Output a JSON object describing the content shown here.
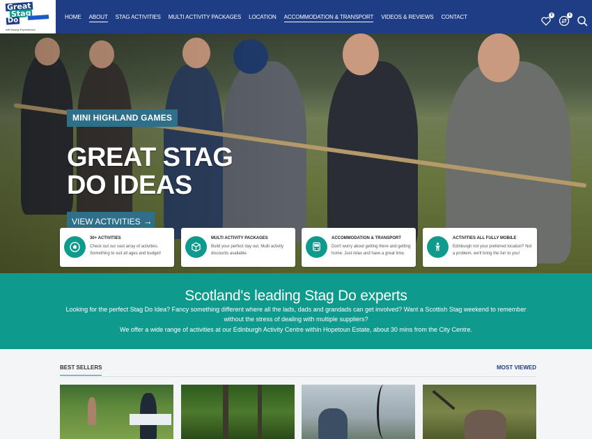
{
  "brand": {
    "logo_line1": "Great",
    "logo_line2": "Stag",
    "logo_line3": "Do",
    "logo_tagline": "with Buddy Experiences"
  },
  "nav": {
    "items": [
      {
        "label": "HOME"
      },
      {
        "label": "ABOUT"
      },
      {
        "label": "STAG ACTIVITIES"
      },
      {
        "label": "MULTI ACTIVITY PACKAGES"
      },
      {
        "label": "LOCATION"
      },
      {
        "label": "ACCOMMODATION & TRANSPORT"
      },
      {
        "label": "VIDEOS & REVIEWS"
      },
      {
        "label": "CONTACT"
      }
    ],
    "wishlist_count": "0",
    "compare_count": "0",
    "icons": [
      "heart-icon",
      "compare-icon",
      "search-icon"
    ]
  },
  "hero": {
    "tag": "MINI HIGHLAND GAMES",
    "title_line1": "GREAT STAG",
    "title_line2": "DO IDEAS",
    "button_label": "VIEW ACTIVITIES",
    "features": [
      {
        "icon": "soccer-ball-icon",
        "title": "30+ ACTIVITIES",
        "desc": "Check out our vast array of activities. Something to suit all ages and budget!"
      },
      {
        "icon": "box-icon",
        "title": "MULTI ACTIVITY PACKAGES",
        "desc": "Build your perfect day out. Multi activity discounts available."
      },
      {
        "icon": "bus-icon",
        "title": "ACCOMMODATION & TRANSPORT",
        "desc": "Don't worry about getting there and getting home. Just relax and have a great time."
      },
      {
        "icon": "person-icon",
        "title": "ACTIVITIES ALL FULLY MOBILE",
        "desc": "Edinburgh not your preferred location? Not a problem, we'll bring the fun to you!"
      }
    ]
  },
  "intro": {
    "heading": "Scotland's leading Stag Do experts",
    "para1": "Looking for the perfect Stag Do Idea? Fancy something different where all the lads, dads and grandads can get involved? Want a Scottish Stag weekend to remember without the stress of dealing with multiple suppliers?",
    "para2": "We offer a wide range of activities at our Edinburgh Activity Centre within Hopetoun Estate, about 30 mins from the City Centre."
  },
  "products": {
    "tab_left": "BEST SELLERS",
    "tab_right": "MOST VIEWED"
  },
  "colors": {
    "header_bg": "#1e3d84",
    "teal": "#0f9a8e",
    "hero_tag_bg": "#2f6f8a"
  }
}
